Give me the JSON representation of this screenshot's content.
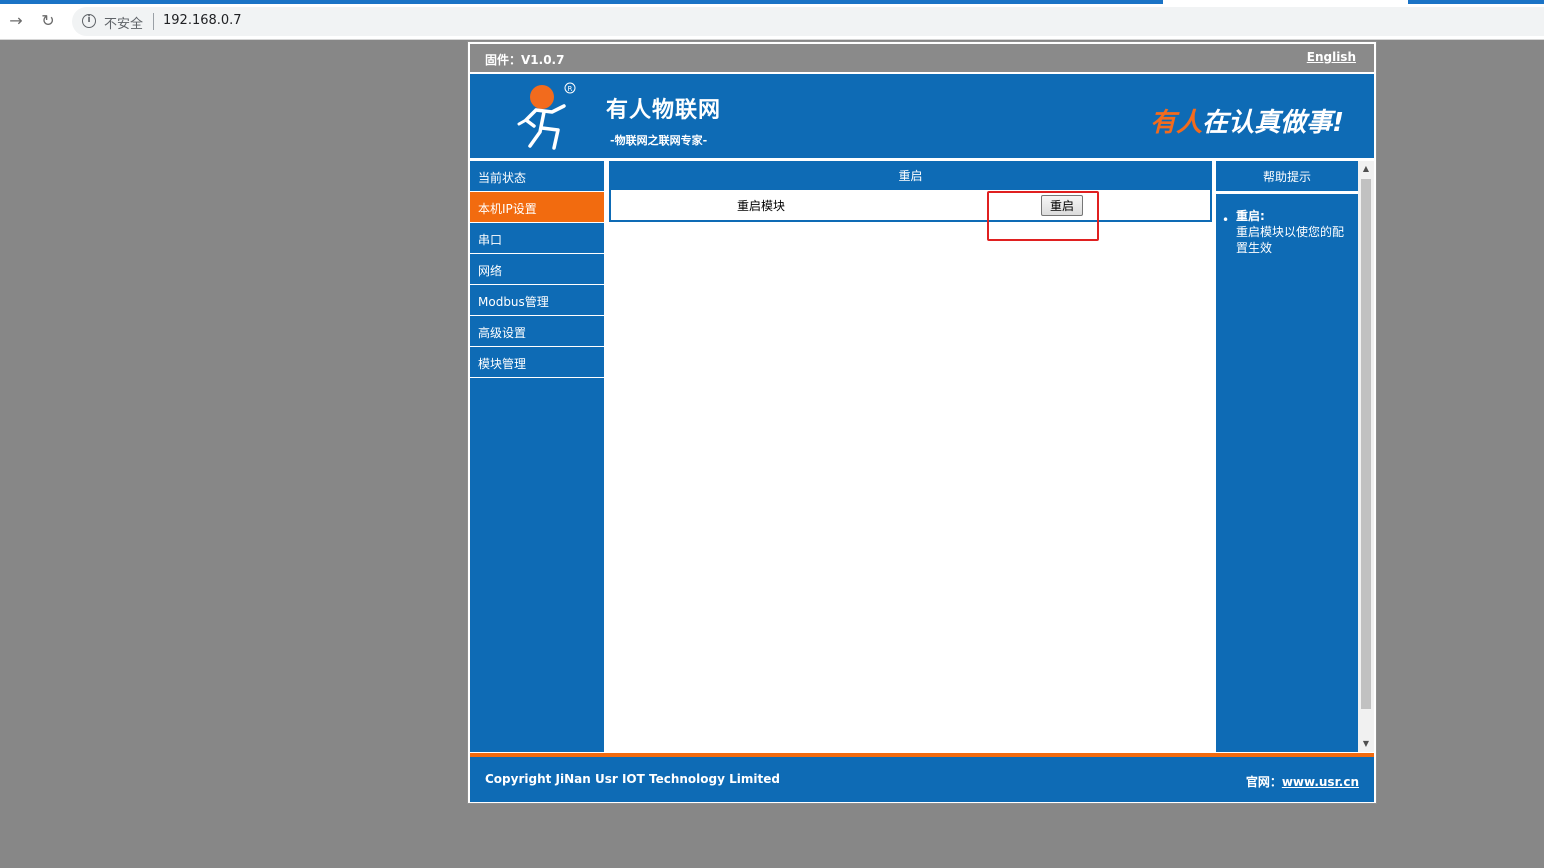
{
  "browser": {
    "security_label": "不安全",
    "url": "192.168.0.7"
  },
  "top_bar": {
    "firmware": "固件：V1.0.7",
    "language_link": "English"
  },
  "header": {
    "brand": "有人物联网",
    "tagline": "-物联网之联网专家-",
    "slogan_highlight": "有人",
    "slogan_rest": "在认真做事!"
  },
  "sidebar": {
    "items": [
      {
        "label": "当前状态"
      },
      {
        "label": "本机IP设置"
      },
      {
        "label": "串口"
      },
      {
        "label": "网络"
      },
      {
        "label": "Modbus管理"
      },
      {
        "label": "高级设置"
      },
      {
        "label": "模块管理"
      }
    ],
    "active_index": 1
  },
  "main": {
    "panel_title": "重启",
    "row_label": "重启模块",
    "button_label": "重启"
  },
  "help": {
    "title": "帮助提示",
    "term": "重启:",
    "description": "重启模块以使您的配置生效"
  },
  "footer": {
    "copyright": "Copyright JiNan Usr IOT Technology Limited",
    "site_label": "官网：",
    "site_link": "www.usr.cn"
  },
  "colors": {
    "primary_blue": "#0e6bb5",
    "accent_orange": "#f26b0f",
    "highlight_red": "#e02020"
  }
}
